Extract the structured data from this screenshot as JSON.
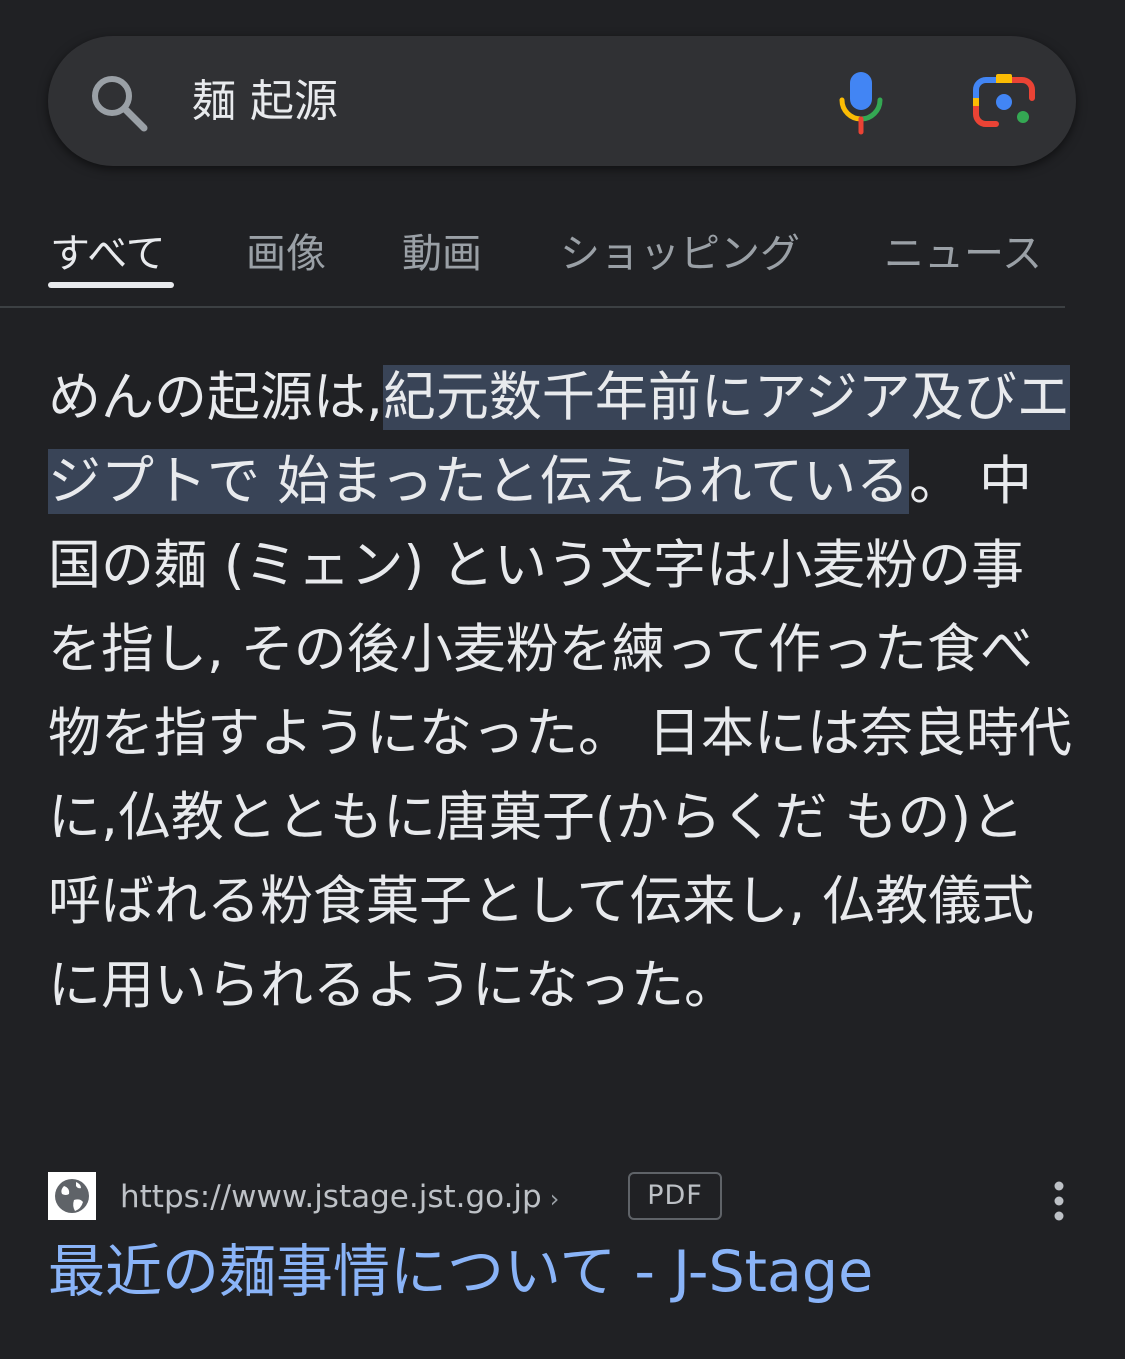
{
  "search": {
    "query": "麺 起源",
    "icons": [
      "search-icon",
      "mic-icon",
      "lens-icon"
    ]
  },
  "tabs": [
    {
      "label": "すべて",
      "active": true
    },
    {
      "label": "画像",
      "active": false
    },
    {
      "label": "動画",
      "active": false
    },
    {
      "label": "ショッピング",
      "active": false
    },
    {
      "label": "ニュース",
      "active": false
    }
  ],
  "snippet": {
    "before": "めんの起源は,",
    "highlight": "紀元数千年前にアジア及びエジプトで 始まったと伝えられている",
    "after": "。 中国の麺 (ミェン) という文字は小麦粉の事を指し, その後小麦粉を練って作った食べ物を指すようになった。 日本には奈良時代に,仏教とともに唐菓子(からくだ もの)と呼ばれる粉食菓子として伝来し, 仏教儀式に用いられるようになった。"
  },
  "result": {
    "url": "https://www.jstage.jst.go.jp",
    "chevron": "›",
    "badge": "PDF",
    "title": "最近の麺事情について - J-Stage"
  },
  "colors": {
    "background": "#202124",
    "search_bar": "#303134",
    "text": "#e8eaed",
    "muted_text": "#9aa0a6",
    "highlight": "#394457",
    "link": "#8ab4f8"
  }
}
